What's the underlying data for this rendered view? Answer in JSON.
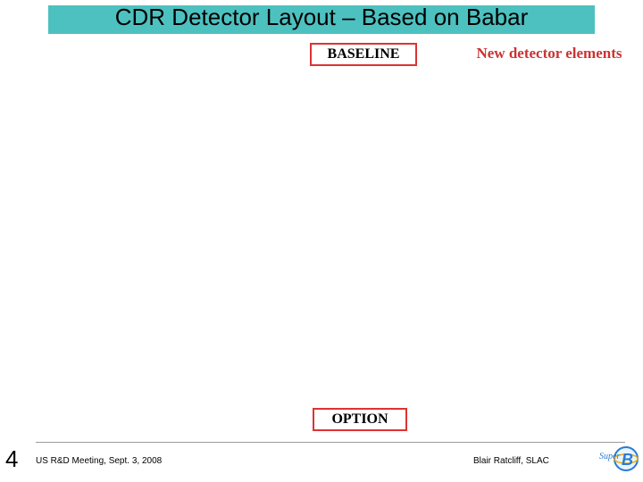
{
  "title": "CDR Detector Layout – Based on Babar",
  "labels": {
    "baseline": "BASELINE",
    "option": "OPTION",
    "new_detector": "New detector elements"
  },
  "footer": {
    "page": "4",
    "meeting": "US R&D Meeting, Sept. 3, 2008",
    "author": "Blair Ratcliff, SLAC"
  },
  "logo": {
    "name": "SuperB"
  }
}
